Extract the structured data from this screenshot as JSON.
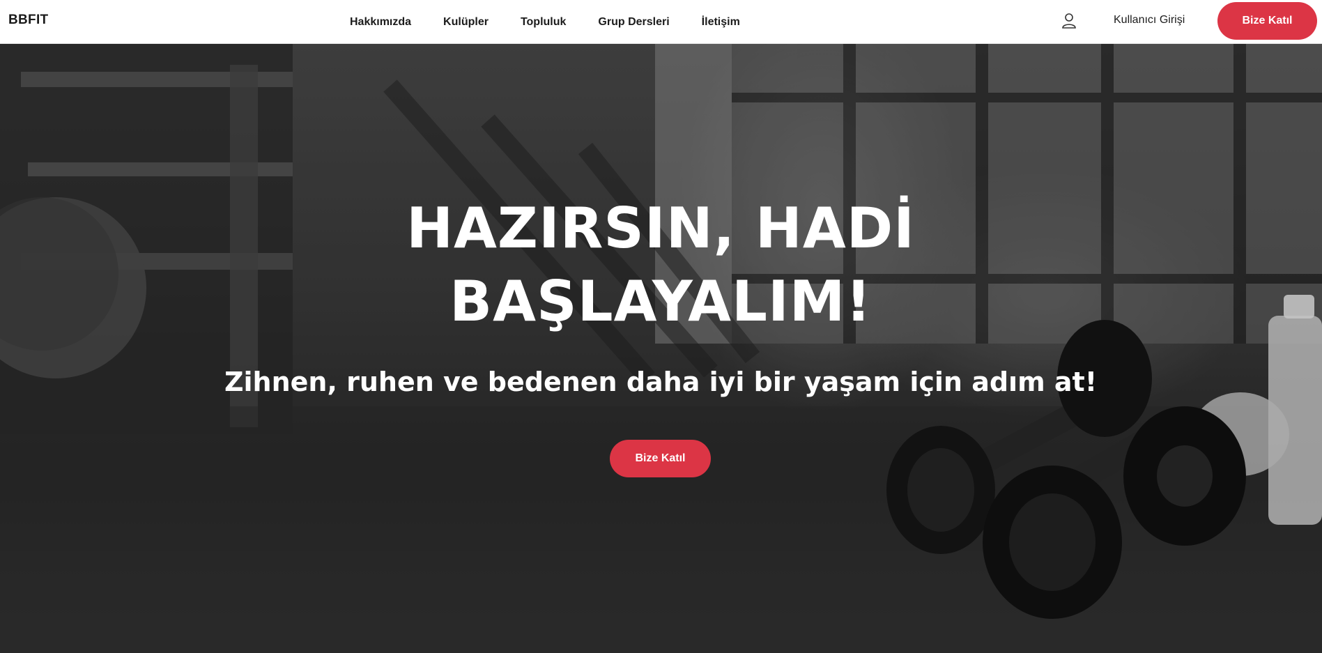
{
  "nav": {
    "brand": "BBFIT",
    "links": [
      "Hakkımızda",
      "Kulüpler",
      "Topluluk",
      "Grup Dersleri",
      "İletişim"
    ],
    "user_icon": "user-icon",
    "login_label": "Kullanıcı Girişi",
    "join_label": "Bize Katıl"
  },
  "hero": {
    "title_line1": "HAZIRSIN, HADİ",
    "title_line2": "BAŞLAYALIM!",
    "subtitle": "Zihnen, ruhen ve bedenen daha iyi bir yaşam için adım at!",
    "cta_label": "Bize Katıl",
    "background_image": "grayscale gym interior with dumbbells"
  },
  "colors": {
    "accent": "#dc3545",
    "nav_bg": "#ffffff",
    "text_dark": "#1b1b1b",
    "hero_text": "#ffffff"
  }
}
